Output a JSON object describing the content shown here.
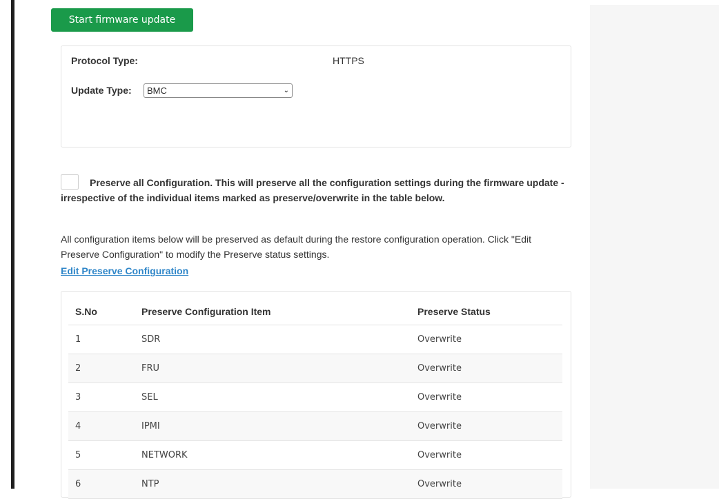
{
  "start_button": {
    "label": "Start firmware update"
  },
  "protocol": {
    "label": "Protocol Type:",
    "value": "HTTPS"
  },
  "update_type": {
    "label": "Update Type:",
    "selected": "BMC"
  },
  "preserve_all": {
    "checked": false,
    "text": "Preserve all Configuration. This will preserve all the configuration settings during the firmware update - irrespective of the individual items marked as preserve/overwrite in the table below."
  },
  "info": {
    "text": "All configuration items below will be preserved as default during the restore configuration operation. Click \"Edit Preserve Configuration\" to modify the Preserve status settings."
  },
  "edit_link": {
    "label": "Edit Preserve Configuration"
  },
  "table": {
    "headers": [
      "S.No",
      "Preserve Configuration Item",
      "Preserve Status"
    ],
    "rows": [
      [
        "1",
        "SDR",
        "Overwrite"
      ],
      [
        "2",
        "FRU",
        "Overwrite"
      ],
      [
        "3",
        "SEL",
        "Overwrite"
      ],
      [
        "4",
        "IPMI",
        "Overwrite"
      ],
      [
        "5",
        "NETWORK",
        "Overwrite"
      ],
      [
        "6",
        "NTP",
        "Overwrite"
      ]
    ]
  }
}
